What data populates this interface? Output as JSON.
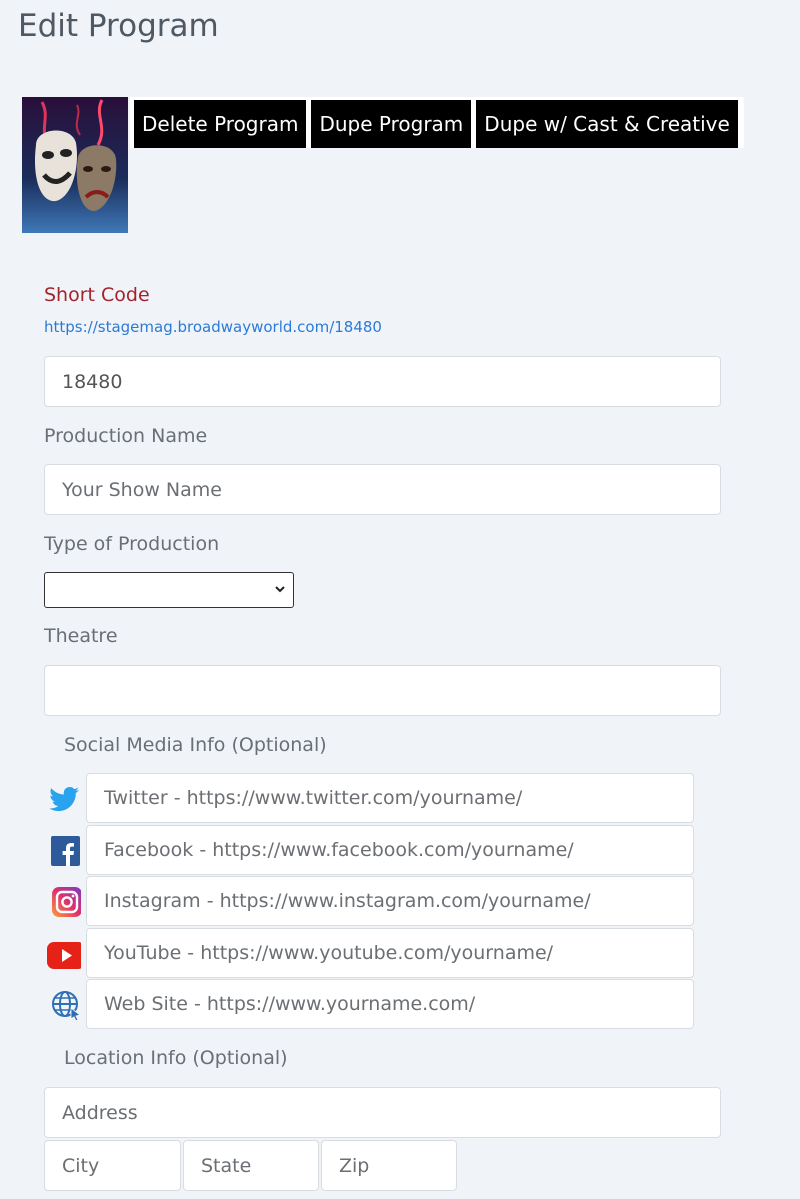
{
  "page": {
    "title": "Edit Program"
  },
  "toolbar": {
    "delete_label": "Delete Program",
    "dupe_label": "Dupe Program",
    "dupe_cast_label": "Dupe w/ Cast & Creative"
  },
  "short_code": {
    "label": "Short Code",
    "link": "https://stagemag.broadwayworld.com/18480",
    "value": "18480"
  },
  "production_name": {
    "label": "Production Name",
    "placeholder": "Your Show Name"
  },
  "type_of_production": {
    "label": "Type of Production",
    "selected": ""
  },
  "theatre": {
    "label": "Theatre",
    "value": ""
  },
  "social": {
    "heading": "Social Media Info (Optional)",
    "items": [
      {
        "icon": "twitter-icon",
        "placeholder": "Twitter - https://www.twitter.com/yourname/"
      },
      {
        "icon": "facebook-icon",
        "placeholder": "Facebook - https://www.facebook.com/yourname/"
      },
      {
        "icon": "instagram-icon",
        "placeholder": "Instagram - https://www.instagram.com/yourname/"
      },
      {
        "icon": "youtube-icon",
        "placeholder": "YouTube - https://www.youtube.com/yourname/"
      },
      {
        "icon": "website-icon",
        "placeholder": "Web Site - https://www.yourname.com/"
      }
    ]
  },
  "location": {
    "heading": "Location Info (Optional)",
    "address_placeholder": "Address",
    "city_placeholder": "City",
    "state_placeholder": "State",
    "zip_placeholder": "Zip"
  },
  "colors": {
    "background": "#f0f4f9",
    "accent_red": "#a3232b",
    "link_blue": "#2b7bd6",
    "twitter": "#1d9bf0",
    "facebook": "#1877f2",
    "youtube": "#ff0000"
  }
}
